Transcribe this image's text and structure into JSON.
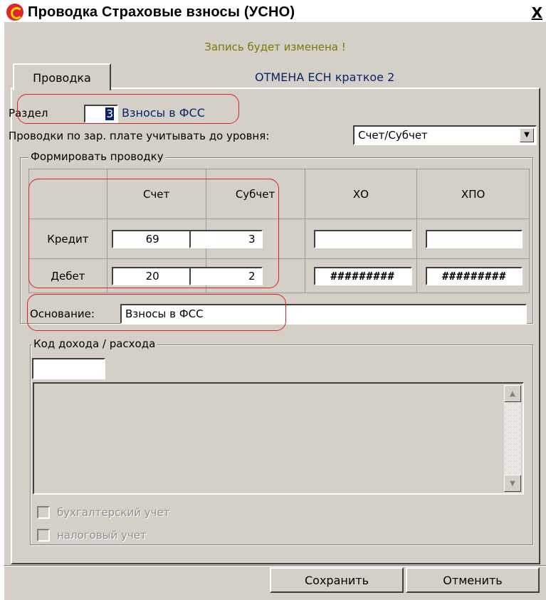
{
  "window": {
    "title": "Проводка Страховые взносы (УСНО)",
    "close_label": "X",
    "status": "Запись будет изменена !"
  },
  "tab": {
    "label": "Проводка",
    "caption": "ОТМЕНА ЕСН краткое 2"
  },
  "section": {
    "label": "Раздел",
    "value": "3",
    "name": "Взносы в ФСС"
  },
  "level": {
    "label": "Проводки по зар. плате учитывать до уровня:",
    "value": "Счет/Субчет"
  },
  "posting_group": {
    "title": "Формировать проводку",
    "headers": [
      "Счет",
      "Субчет",
      "ХО",
      "ХПО"
    ],
    "rows": [
      {
        "label": "Кредит",
        "account": "69",
        "subaccount": "3",
        "ho": "",
        "hpo": ""
      },
      {
        "label": "Дебет",
        "account": "20",
        "subaccount": "2",
        "ho": "#########",
        "hpo": "#########"
      }
    ]
  },
  "basis": {
    "label": "Основание:",
    "value": "Взносы в ФСС"
  },
  "income_group": {
    "title": "Код дохода / расхода",
    "code_value": ""
  },
  "checkboxes": {
    "accounting": "бухгалтерский учет",
    "tax": "налоговый учет"
  },
  "buttons": {
    "save": "Сохранить",
    "cancel": "Отменить"
  }
}
